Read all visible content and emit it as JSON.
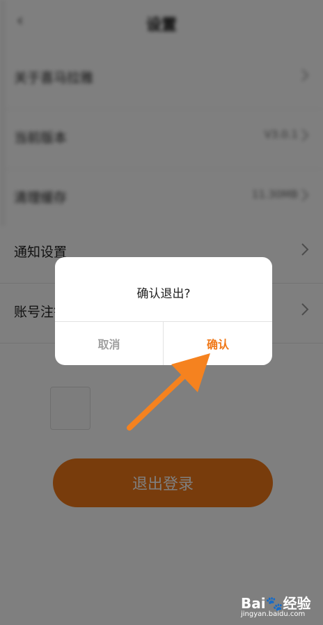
{
  "header": {
    "title": "设置"
  },
  "rows": [
    {
      "label": "关于喜马拉雅",
      "value": ""
    },
    {
      "label": "当前版本",
      "value": "V3.0.1"
    },
    {
      "label": "清理缓存",
      "value": "11.30MB"
    },
    {
      "label": "通知设置",
      "value": ""
    },
    {
      "label": "账号注销",
      "value": ""
    }
  ],
  "logout_button": "退出登录",
  "dialog": {
    "title": "确认退出?",
    "cancel": "取消",
    "confirm": "确认"
  },
  "watermark": {
    "logo": "Bai🐾经验",
    "url": "jingyan.baidu.com"
  },
  "colors": {
    "accent": "#f07818",
    "overlay": "rgba(0,0,0,0.5)",
    "dialog_bg": "#ffffff"
  }
}
